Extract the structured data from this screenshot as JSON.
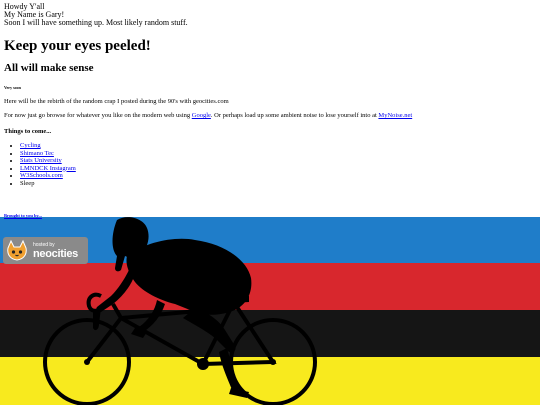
{
  "intro": {
    "greeting": "Howdy Y'all",
    "name_line": "My Name is Gary!",
    "soon_line": "Soon I will have something up. Most likely random stuff."
  },
  "headings": {
    "main": "Keep your eyes peeled!",
    "sub": "All will make sense",
    "tiny": "Very soon"
  },
  "paragraphs": {
    "rebirth": "Here will be the rebirth of the random crap I posted during the 90's with geocities.com",
    "browse_prefix": "For now just go browse for whatever you like on the modern web using ",
    "google_link": "Google",
    "browse_middle": ". Or perhaps load up some ambient noise to lose yourself into at ",
    "mynoise_link": "MyNoise.net"
  },
  "things": {
    "heading": "Things to come...",
    "items": [
      {
        "label": "Cycling",
        "link": true
      },
      {
        "label": "Shimano Tec",
        "link": true
      },
      {
        "label": "Stats University",
        "link": true
      },
      {
        "label": "LMNDCK Instagram",
        "link": true
      },
      {
        "label": "W3Schools.com",
        "link": true
      },
      {
        "label": "Sleep",
        "link": false
      }
    ]
  },
  "footer": {
    "brought": "Brought to you by...",
    "badge_small": "hosted by",
    "badge_big": "neocities"
  },
  "colors": {
    "stripe_blue": "#1f7dc9",
    "stripe_red": "#d8272d",
    "stripe_black": "#151515",
    "stripe_yellow": "#f8ea1e",
    "link": "#0000ee"
  },
  "icons": [
    "neocities-cat-icon",
    "cyclist-silhouette"
  ]
}
